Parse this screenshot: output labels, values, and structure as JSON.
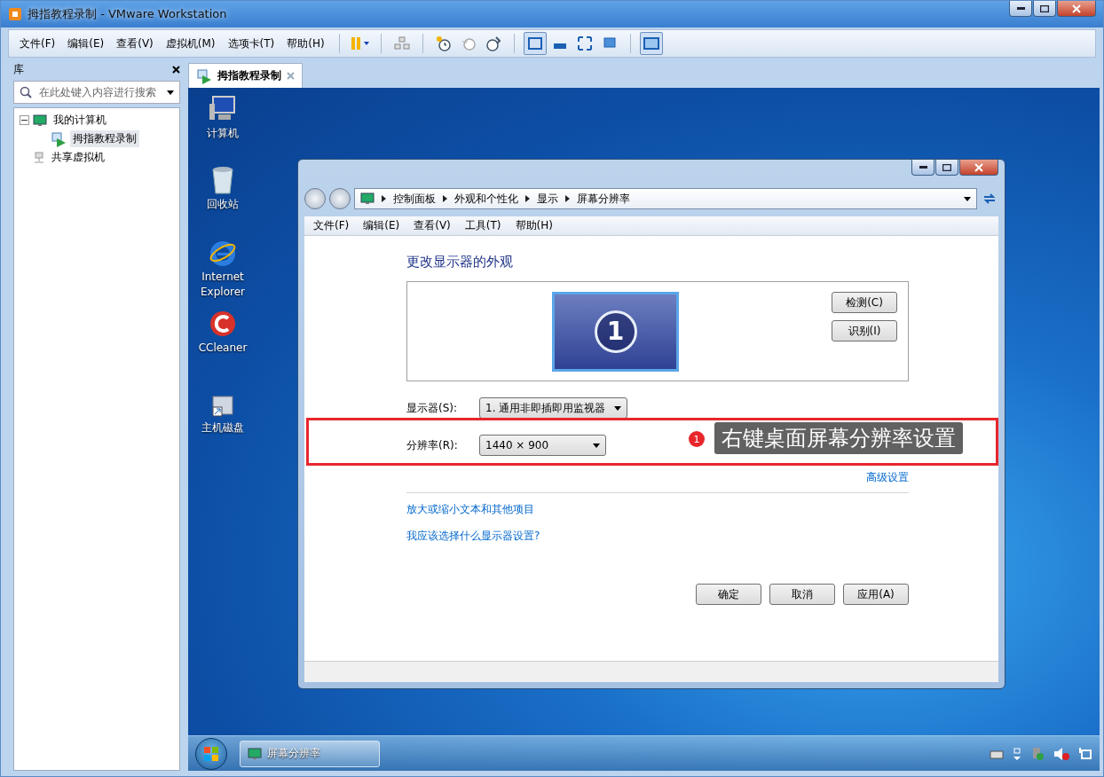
{
  "window": {
    "title": "拇指教程录制 - VMware Workstation"
  },
  "menu": [
    "文件(F)",
    "编辑(E)",
    "查看(V)",
    "虚拟机(M)",
    "选项卡(T)",
    "帮助(H)"
  ],
  "view_buttons": [
    {
      "selected": true
    },
    {
      "selected": false
    },
    {
      "selected": false
    },
    {
      "selected": false
    },
    {
      "selected": true
    }
  ],
  "library": {
    "title": "库",
    "search": {
      "placeholder": "在此处键入内容进行搜索"
    },
    "tree": [
      {
        "label": "我的计算机",
        "kind": "computer",
        "expanded": true,
        "children": [
          {
            "label": "拇指教程录制",
            "kind": "vm",
            "selected": true
          }
        ]
      },
      {
        "label": "共享虚拟机",
        "kind": "shared",
        "selected": false
      }
    ]
  },
  "tabs": [
    {
      "label": "拇指教程录制",
      "selected": true
    }
  ],
  "desktop": {
    "icons": [
      {
        "label": "计算机",
        "kind": "computer"
      },
      {
        "label": "回收站",
        "kind": "bin"
      },
      {
        "label": "Internet Explorer",
        "kind": "ie"
      },
      {
        "label": "CCleaner",
        "kind": "ccleaner"
      },
      {
        "label": "主机磁盘",
        "kind": "disk"
      }
    ]
  },
  "dialog": {
    "breadcrumb": [
      "控制面板",
      "外观和个性化",
      "显示",
      "屏幕分辨率"
    ],
    "menu": [
      "文件(F)",
      "编辑(E)",
      "查看(V)",
      "工具(T)",
      "帮助(H)"
    ],
    "heading": "更改显示器的外观",
    "monitor_number": "1",
    "side_buttons": [
      "检测(C)",
      "识别(I)"
    ],
    "fields": [
      {
        "label": "显示器(S):",
        "value": "1. 通用非即插即用监视器"
      },
      {
        "label": "分辨率(R):",
        "value": "1440 × 900"
      }
    ],
    "advanced_link": "高级设置",
    "links": [
      "放大或缩小文本和其他项目",
      "我应该选择什么显示器设置?"
    ],
    "buttons": [
      "确定",
      "取消",
      "应用(A)"
    ]
  },
  "annotation": {
    "number": "1",
    "text": "右键桌面屏幕分辨率设置"
  },
  "taskbar": {
    "items": [
      {
        "label": "屏幕分辨率"
      }
    ]
  }
}
